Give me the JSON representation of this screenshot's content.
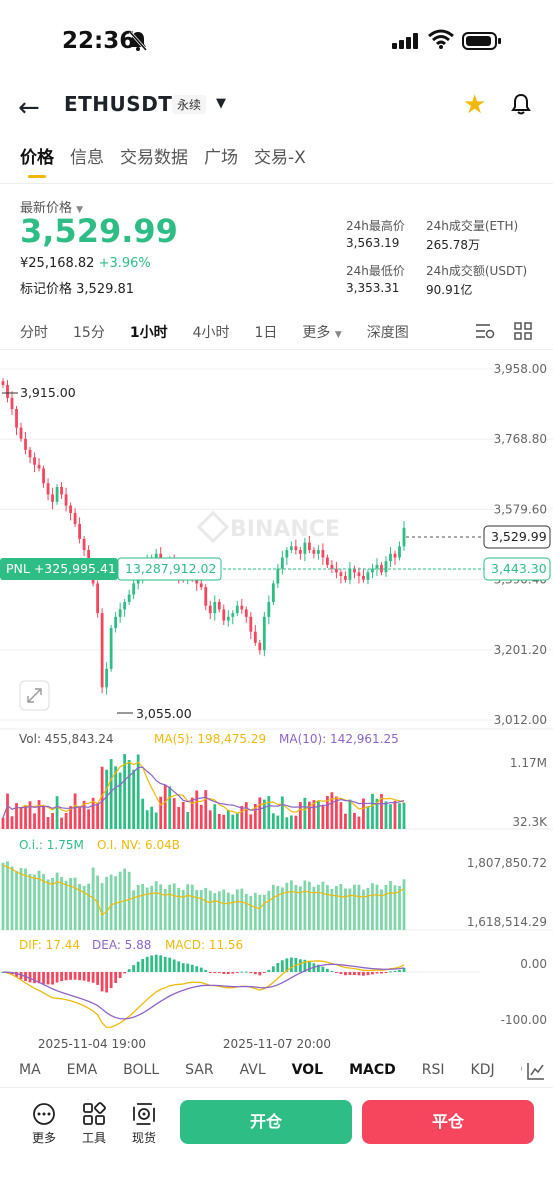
{
  "status_bar": {
    "time": "22:36"
  },
  "header": {
    "symbol": "ETHUSDT",
    "contract_type": "永续"
  },
  "tabs": [
    "价格",
    "信息",
    "交易数据",
    "广场",
    "交易-X"
  ],
  "price": {
    "label": "最新价格",
    "last": "3,529.99",
    "cny": "¥25,168.82",
    "change": "+3.96%",
    "mark_label": "标记价格",
    "mark": "3,529.81"
  },
  "stats": {
    "high_label": "24h最高价",
    "high": "3,563.19",
    "vol_eth_label": "24h成交量(ETH)",
    "vol_eth": "265.78万",
    "low_label": "24h最低价",
    "low": "3,353.31",
    "vol_usdt_label": "24h成交额(USDT)",
    "vol_usdt": "90.91亿"
  },
  "intervals": [
    "分时",
    "15分",
    "1小时",
    "4小时",
    "1日",
    "更多",
    "深度图"
  ],
  "chart_data": {
    "type": "candlestick",
    "y_ticks": [
      "3,958.00",
      "3,768.80",
      "3,579.60",
      "3,390.40",
      "3,201.20",
      "3,012.00"
    ],
    "ylim": [
      3012.0,
      3958.0
    ],
    "high_annotation": "3,915.00",
    "low_annotation": "3,055.00",
    "last_price_tag": "3,529.99",
    "position_line_tag": "3,443.30",
    "pnl_label": "PNL +325,995.41",
    "position_size": "13,287,912.02",
    "watermark": "BINANCE",
    "x_labels": [
      "2025-11-04 19:00",
      "2025-11-07 20:00"
    ],
    "closes": [
      3915,
      3880,
      3850,
      3800,
      3770,
      3740,
      3720,
      3700,
      3690,
      3650,
      3620,
      3600,
      3640,
      3620,
      3590,
      3570,
      3540,
      3500,
      3470,
      3420,
      3380,
      3300,
      3100,
      3150,
      3260,
      3290,
      3310,
      3330,
      3350,
      3380,
      3400,
      3420,
      3440,
      3450,
      3460,
      3440,
      3420,
      3440,
      3410,
      3400,
      3390,
      3420,
      3400,
      3380,
      3370,
      3320,
      3300,
      3330,
      3310,
      3280,
      3290,
      3300,
      3320,
      3310,
      3290,
      3250,
      3220,
      3200,
      3290,
      3330,
      3380,
      3420,
      3450,
      3470,
      3480,
      3470,
      3460,
      3490,
      3470,
      3460,
      3470,
      3450,
      3430,
      3420,
      3410,
      3400,
      3390,
      3420,
      3410,
      3400,
      3390,
      3410,
      3420,
      3430,
      3410,
      3440,
      3460,
      3450,
      3480,
      3530
    ]
  },
  "volume": {
    "vol_label": "Vol: 455,843.24",
    "ma5_label": "MA(5): 198,475.29",
    "ma10_label": "MA(10): 142,961.25",
    "max_tick": "1.17M",
    "min_tick": "32.3K"
  },
  "open_interest": {
    "oi_label": "O.i.: 1.75M",
    "oinv_label": "O.I. NV: 6.04B",
    "max_tick": "1,807,850.72",
    "min_tick": "1,618,514.29"
  },
  "macd": {
    "dif_label": "DIF: 17.44",
    "dea_label": "DEA: 5.88",
    "macd_label": "MACD: 11.56",
    "zero_tick": "0.00",
    "min_tick": "-100.00"
  },
  "indicator_tabs": [
    "MA",
    "EMA",
    "BOLL",
    "SAR",
    "AVL",
    "VOL",
    "MACD",
    "RSI",
    "KDJ",
    "O"
  ],
  "actions": {
    "more": "更多",
    "tools": "工具",
    "spot": "现货",
    "open": "开仓",
    "close": "平仓"
  },
  "colors": {
    "up": "#2ebd85",
    "down": "#f6465d",
    "accent": "#f0b90b"
  }
}
